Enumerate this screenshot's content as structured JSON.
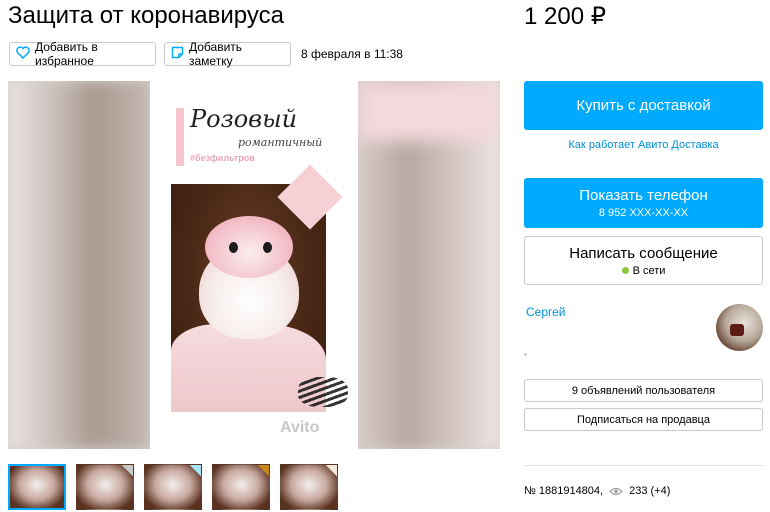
{
  "listing": {
    "title": "Защита от коронавируса",
    "price": "1 200 ₽",
    "date": "8 февраля в 11:38",
    "favorite_label": "Добавить в избранное",
    "note_label": "Добавить заметку"
  },
  "gallery": {
    "photo_title": "Розовый",
    "photo_subtitle": "романтичный",
    "photo_tag": "#безфильтров",
    "watermark": "Avito",
    "thumbnails": [
      {
        "mark_color": "",
        "active": true
      },
      {
        "mark_color": "#c9c9c9",
        "active": false
      },
      {
        "mark_color": "#a8e4f5",
        "active": false
      },
      {
        "mark_color": "#c8861e",
        "active": false
      },
      {
        "mark_color": "#f2eadb",
        "active": false
      }
    ]
  },
  "actions": {
    "buy_label": "Купить с доставкой",
    "delivery_link": "Как работает Авито Доставка",
    "phone_label": "Показать телефон",
    "phone_number": "8 952 XXX-XX-XX",
    "message_label": "Написать сообщение",
    "online_status": "В сети"
  },
  "seller": {
    "name": "Сергей",
    "ads_label": "9 объявлений пользователя",
    "subscribe_label": "Подписаться на продавца"
  },
  "meta": {
    "ad_number": "№ 1881914804,",
    "views": "233 (+4)"
  },
  "colors": {
    "accent": "#00aaff",
    "link": "#0091d9",
    "online": "#8bc640"
  }
}
